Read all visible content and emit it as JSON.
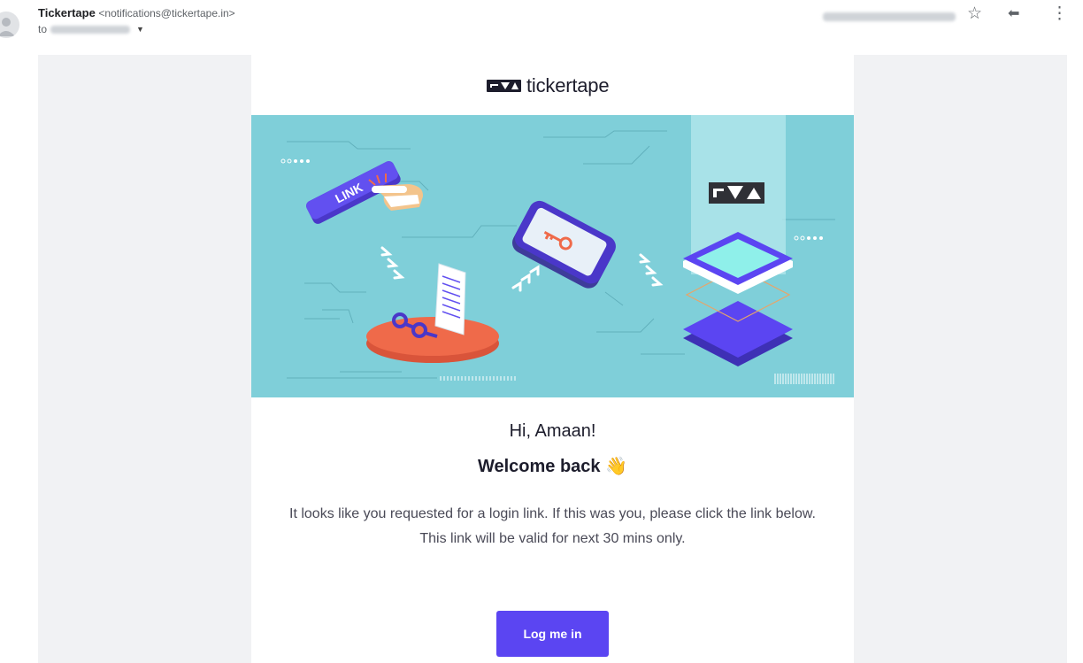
{
  "header": {
    "sender_name": "Tickertape",
    "sender_email": "<notifications@tickertape.in>",
    "to_prefix": "to",
    "icons": {
      "avatar": "person-avatar-icon",
      "star": "star-outline-icon",
      "reply": "reply-arrow-icon",
      "more": "more-vert-icon"
    },
    "star_glyph": "☆",
    "reply_glyph": "⬅",
    "more_glyph": "⋮"
  },
  "email": {
    "brand_text": "tickertape",
    "hero_badge_text": "LINK",
    "greeting": "Hi, Amaan!",
    "welcome": "Welcome back 👋",
    "body_line_1": "It looks like you requested for a login link. If this was you, please click the link below.",
    "body_line_2": "This link will be valid for next 30 mins only.",
    "cta_label": "Log me in"
  },
  "colors": {
    "hero_bg": "#7fcfd9",
    "accent_purple": "#5b45f2",
    "platform_orange": "#ef6a4a",
    "brand_dark": "#1d1d2c",
    "canvas_gray": "#f1f2f4"
  }
}
